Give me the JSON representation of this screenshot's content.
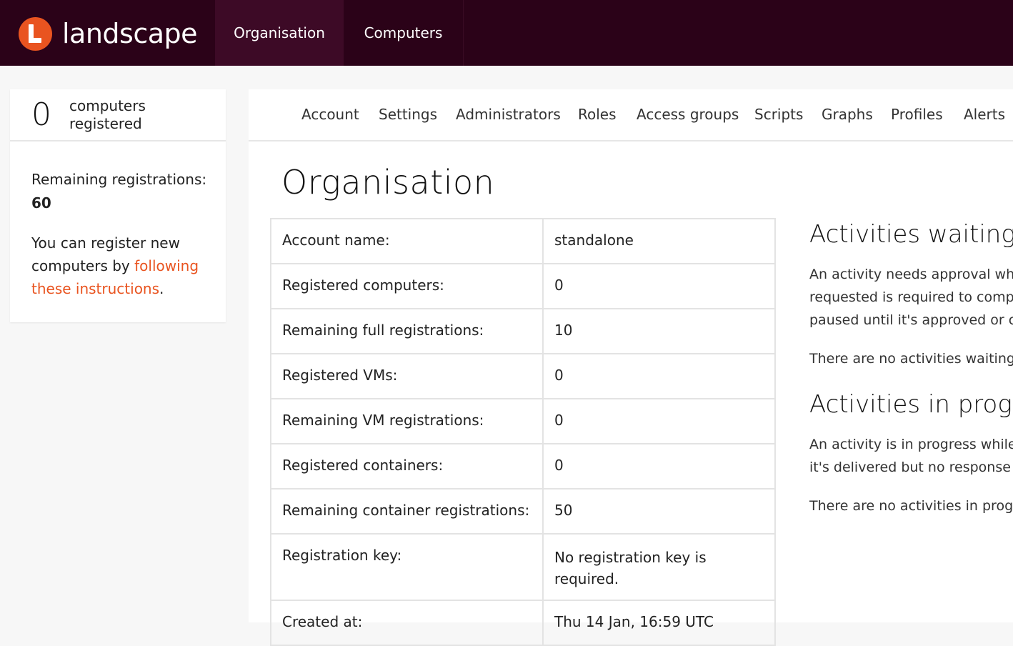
{
  "topbar": {
    "logo_text": "landscape",
    "nav": [
      "Organisation",
      "Computers"
    ],
    "active": "Organisation"
  },
  "sidebar": {
    "count": "0",
    "count_label": "computers registered",
    "remaining_label": "Remaining registrations:",
    "remaining_value": "60",
    "register_prefix": "You can register new computers by ",
    "register_link": "following these instructions",
    "register_suffix": "."
  },
  "subnav": {
    "items": [
      "Account",
      "Settings",
      "Administrators",
      "Roles",
      "Access groups",
      "Scripts",
      "Graphs",
      "Profiles",
      "Alerts"
    ]
  },
  "main": {
    "title": "Organisation",
    "rows": [
      {
        "key": "Account name:",
        "value": "standalone"
      },
      {
        "key": "Registered computers:",
        "value": "0"
      },
      {
        "key": "Remaining full registrations:",
        "value": "10"
      },
      {
        "key": "Registered VMs:",
        "value": "0"
      },
      {
        "key": "Remaining VM registrations:",
        "value": "0"
      },
      {
        "key": "Registered containers:",
        "value": "0"
      },
      {
        "key": "Remaining container registrations:",
        "value": "50"
      },
      {
        "key": "Registration key:",
        "value": "No registration key is required."
      },
      {
        "key": "Created at:",
        "value": "Thu 14 Jan, 16:59 UTC"
      }
    ]
  },
  "aside": {
    "waiting_title": "Activities waiting f",
    "waiting_desc": [
      "An activity needs approval whe",
      "requested is required to comp",
      "paused until it's approved or c"
    ],
    "waiting_empty": "There are no activities waiting",
    "progress_title": "Activities in progre",
    "progress_desc": [
      "An activity is in progress while",
      "it's delivered but no response"
    ],
    "progress_empty": "There are no activities in progr"
  },
  "colors": {
    "topbar": "#2b0218",
    "active_tab": "#3d0a26",
    "accent": "#e95420"
  }
}
